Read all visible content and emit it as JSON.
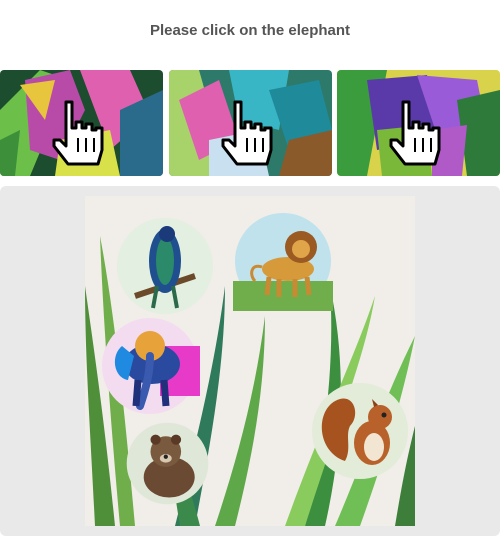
{
  "prompt": {
    "text": "Please click on the elephant"
  },
  "examples": [
    {
      "name": "example-elephant-1",
      "colors": [
        "#1c4d2e",
        "#b84aa8",
        "#e7c53c",
        "#6cc04a"
      ]
    },
    {
      "name": "example-elephant-2",
      "colors": [
        "#2d7a6a",
        "#e060b0",
        "#39b6c6",
        "#a8d36a"
      ]
    },
    {
      "name": "example-elephant-3",
      "colors": [
        "#5a3aa8",
        "#9a5bd8",
        "#3a9c3c",
        "#d8d34a"
      ]
    }
  ],
  "canvas": {
    "background": "#f1ede8",
    "animals": [
      "peacock",
      "lion",
      "elephant",
      "bear",
      "squirrel"
    ]
  }
}
